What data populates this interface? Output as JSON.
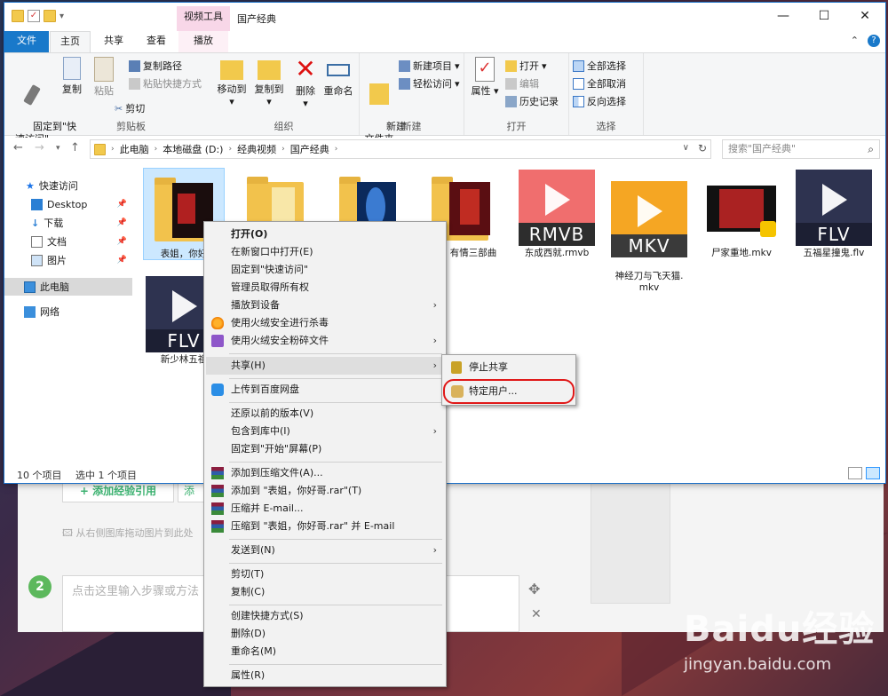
{
  "window": {
    "title": "国产经典",
    "contextual_tab_group": "视频工具",
    "controls": {
      "minimize": "—",
      "maximize": "☐",
      "close": "✕"
    }
  },
  "ribbon_tabs": {
    "file": "文件",
    "home": "主页",
    "share": "共享",
    "view": "查看",
    "play": "播放"
  },
  "ribbon": {
    "clipboard": {
      "label": "剪贴板",
      "pin": "固定到\"快\n速访问\"",
      "copy": "复制",
      "paste": "粘贴",
      "copy_path": "复制路径",
      "paste_shortcut": "粘贴快捷方式",
      "cut": "剪切"
    },
    "organize": {
      "label": "组织",
      "move_to": "移动到",
      "copy_to": "复制到",
      "delete": "删除",
      "rename": "重命名"
    },
    "new": {
      "label": "新建",
      "new_folder": "新建\n文件夹",
      "new_item": "新建项目",
      "easy_access": "轻松访问"
    },
    "open": {
      "label": "打开",
      "properties": "属性",
      "open": "打开",
      "edit": "编辑",
      "history": "历史记录"
    },
    "select": {
      "label": "选择",
      "select_all": "全部选择",
      "select_none": "全部取消",
      "invert": "反向选择"
    }
  },
  "address": {
    "crumbs": [
      "此电脑",
      "本地磁盘 (D:)",
      "经典视频",
      "国产经典"
    ],
    "search_placeholder": "搜索\"国产经典\""
  },
  "nav_pane": [
    {
      "label": "快速访问",
      "icon": "star-icon"
    },
    {
      "label": "Desktop",
      "icon": "desktop-icon",
      "pinned": true
    },
    {
      "label": "下载",
      "icon": "download-icon",
      "pinned": true
    },
    {
      "label": "文档",
      "icon": "document-icon",
      "pinned": true
    },
    {
      "label": "图片",
      "icon": "picture-icon",
      "pinned": true
    },
    {
      "label": "此电脑",
      "icon": "computer-icon",
      "selected": true
    },
    {
      "label": "网络",
      "icon": "network-icon"
    }
  ],
  "files": [
    {
      "name": "表姐，你好",
      "type": "folder",
      "selected": true
    },
    {
      "name": "",
      "type": "folder"
    },
    {
      "name": "",
      "type": "folder"
    },
    {
      "name": "有情三部曲",
      "type": "folder"
    },
    {
      "name": "东成西就.rmvb",
      "type": "video",
      "ext": "RMVB",
      "color": "#f06e6e"
    },
    {
      "name": "神经刀与飞天猫.\nmkv",
      "type": "video",
      "ext": "MKV",
      "color": "#f5a623"
    },
    {
      "name": "尸家重地.mkv",
      "type": "video-thumb"
    },
    {
      "name": "五福星撞鬼.flv",
      "type": "video",
      "ext": "FLV",
      "color": "#2e3350"
    },
    {
      "name": "新少林五祖",
      "type": "video",
      "ext": "FLV",
      "color": "#2e3350"
    }
  ],
  "status": {
    "count": "10 个项目",
    "selected": "选中 1 个项目"
  },
  "context_menu": {
    "open": "打开(O)",
    "open_new_window": "在新窗口中打开(E)",
    "pin_quick": "固定到\"快速访问\"",
    "take_ownership": "管理员取得所有权",
    "cast": "播放到设备",
    "huorong_scan": "使用火绒安全进行杀毒",
    "huorong_shred": "使用火绒安全粉碎文件",
    "share": "共享(H)",
    "baidu_upload": "上传到百度网盘",
    "restore_versions": "还原以前的版本(V)",
    "include_library": "包含到库中(I)",
    "pin_start": "固定到\"开始\"屏幕(P)",
    "add_archive": "添加到压缩文件(A)...",
    "add_rar": "添加到 \"表姐，你好哥.rar\"(T)",
    "compress_email": "压缩并 E-mail...",
    "compress_rar_email": "压缩到 \"表姐，你好哥.rar\" 并 E-mail",
    "send_to": "发送到(N)",
    "cut": "剪切(T)",
    "copy": "复制(C)",
    "create_shortcut": "创建快捷方式(S)",
    "delete": "删除(D)",
    "rename": "重命名(M)",
    "properties": "属性(R)"
  },
  "share_submenu": {
    "stop_sharing": "停止共享",
    "specific_people": "特定用户..."
  },
  "web_page": {
    "add_ref": "+ 添加经验引用",
    "add_ref2": "添",
    "drag_hint": "从右侧图库拖动图片到此处",
    "step_number": "2",
    "step_placeholder": "点击这里输入步骤或方法"
  },
  "watermark": {
    "logo": "Baidu经验",
    "url": "jingyan.baidu.com"
  }
}
